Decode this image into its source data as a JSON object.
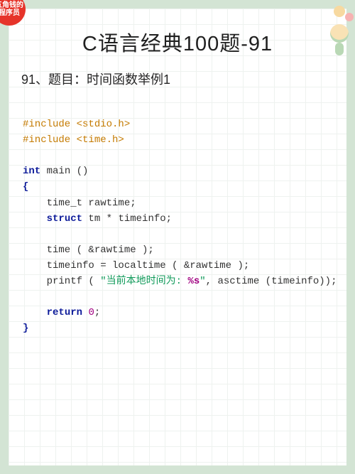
{
  "badge": {
    "line1": "五角钱的",
    "line2": "程序员"
  },
  "title": "C语言经典100题-91",
  "subtitle": "91、题目：时间函数举例1",
  "code": {
    "inc1_a": "#include ",
    "inc1_b": "<stdio.h>",
    "inc2_a": "#include ",
    "inc2_b": "<time.h>",
    "kw_int": "int",
    "fn_main": " main ()",
    "lbrace": "{",
    "l1_a": "    time_t rawtime;",
    "l2_a": "    ",
    "l2_struct": "struct",
    "l2_b": " tm * timeinfo;",
    "l3": "    time ( &rawtime );",
    "l4": "    timeinfo = localtime ( &rawtime );",
    "l5_a": "    printf ( ",
    "l5_str1": "\"当前本地时间为: ",
    "l5_fmt": "%s",
    "l5_str2": "\"",
    "l5_b": ", asctime (timeinfo));",
    "l6_a": "    ",
    "kw_return": "return",
    "l6_b": " ",
    "num0": "0",
    "l6_c": ";",
    "rbrace": "}"
  }
}
